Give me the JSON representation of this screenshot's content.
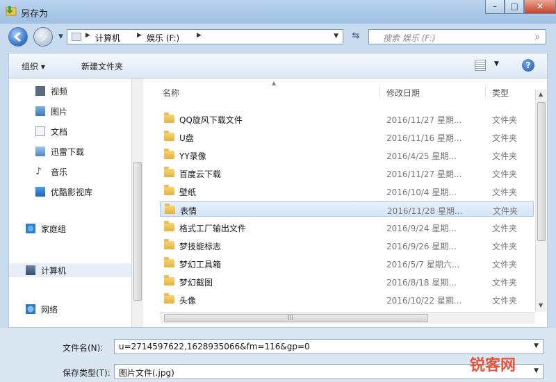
{
  "window": {
    "title": "另存为",
    "min_label": "–",
    "max_label": "□",
    "close_label": "✕"
  },
  "address": {
    "crumbs": [
      "计算机",
      "娱乐 (F:)"
    ],
    "search_placeholder": "搜索 娱乐 (F:)"
  },
  "toolbar": {
    "organize_label": "组织 ▾",
    "new_folder_label": "新建文件夹",
    "help_label": "?"
  },
  "nav": {
    "items": [
      {
        "label": "视频",
        "icon": "video-library-icon"
      },
      {
        "label": "图片",
        "icon": "pictures-library-icon"
      },
      {
        "label": "文档",
        "icon": "documents-library-icon"
      },
      {
        "label": "迅雷下载",
        "icon": "xunlei-download-icon"
      },
      {
        "label": "音乐",
        "icon": "music-library-icon"
      },
      {
        "label": "优酷影视库",
        "icon": "youku-library-icon"
      },
      {
        "label": "家庭组",
        "icon": "homegroup-icon"
      },
      {
        "label": "计算机",
        "icon": "computer-icon"
      },
      {
        "label": "网络",
        "icon": "network-icon"
      }
    ]
  },
  "columns": {
    "name": "名称",
    "date": "修改日期",
    "type": "类型"
  },
  "files": [
    {
      "name": "QQ旋风下载文件",
      "date": "2016/11/27 星期...",
      "type": "文件夹"
    },
    {
      "name": "U盘",
      "date": "2016/11/16 星期...",
      "type": "文件夹"
    },
    {
      "name": "YY录像",
      "date": "2016/4/25 星期...",
      "type": "文件夹"
    },
    {
      "name": "百度云下载",
      "date": "2016/11/27 星期...",
      "type": "文件夹"
    },
    {
      "name": "壁纸",
      "date": "2016/10/4 星期...",
      "type": "文件夹"
    },
    {
      "name": "表情",
      "date": "2016/11/28 星期...",
      "type": "文件夹",
      "selected": true
    },
    {
      "name": "格式工厂输出文件",
      "date": "2016/9/24 星期...",
      "type": "文件夹"
    },
    {
      "name": "梦技能标志",
      "date": "2016/9/26 星期...",
      "type": "文件夹"
    },
    {
      "name": "梦幻工具箱",
      "date": "2016/5/7 星期六...",
      "type": "文件夹"
    },
    {
      "name": "梦幻截图",
      "date": "2016/8/18 星期...",
      "type": "文件夹"
    },
    {
      "name": "头像",
      "date": "2016/10/22 星期...",
      "type": "文件夹"
    }
  ],
  "fields": {
    "filename_label": "文件名(N):",
    "filename_value": "u=2714597622,1628935066&fm=116&gp=0",
    "filetype_label": "保存类型(T):",
    "filetype_value": "图片文件(.jpg)"
  },
  "watermark": "锐客网",
  "colors": {
    "title_bar": "#a9c8e8",
    "selection": "#d3e5f9",
    "folder": "#e3b23c",
    "watermark": "#e8533a"
  }
}
